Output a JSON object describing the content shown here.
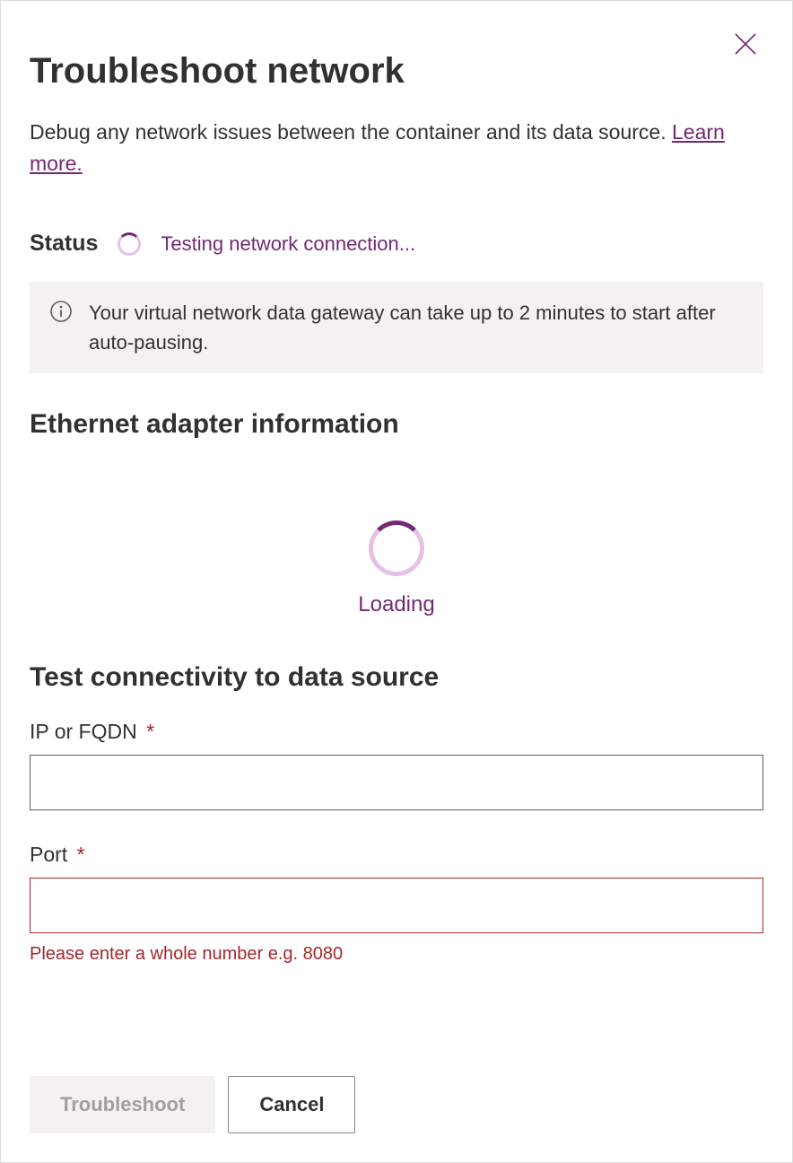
{
  "header": {
    "title": "Troubleshoot network",
    "description": "Debug any network issues between the container and its data source. ",
    "learn_more": "Learn more."
  },
  "status": {
    "label": "Status",
    "message": "Testing network connection..."
  },
  "info_banner": {
    "text": "Your virtual network data gateway can take up to 2 minutes to start after auto-pausing."
  },
  "ethernet": {
    "heading": "Ethernet adapter information",
    "loading_text": "Loading"
  },
  "connectivity": {
    "heading": "Test connectivity to data source",
    "ip_label": "IP or FQDN",
    "ip_value": "",
    "port_label": "Port",
    "port_value": "",
    "port_error": "Please enter a whole number e.g. 8080",
    "required_marker": "*"
  },
  "footer": {
    "troubleshoot": "Troubleshoot",
    "cancel": "Cancel"
  }
}
